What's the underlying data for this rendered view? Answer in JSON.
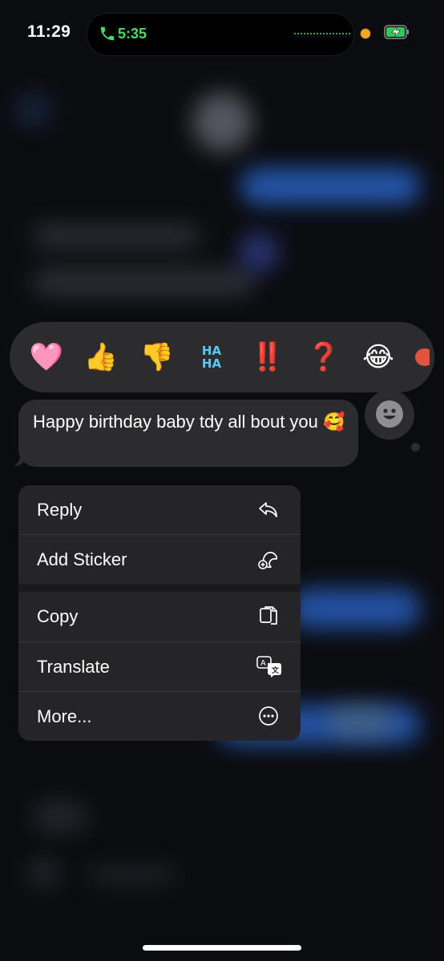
{
  "status_bar": {
    "time": "11:29",
    "call_timer": "5:35",
    "call_color": "#4cd964"
  },
  "reactions": [
    {
      "name": "heart",
      "glyph": "🩷"
    },
    {
      "name": "thumbs-up",
      "glyph": "👍"
    },
    {
      "name": "thumbs-down",
      "glyph": "👎"
    },
    {
      "name": "haha",
      "glyph": "HA HA"
    },
    {
      "name": "exclamation",
      "glyph": "‼️"
    },
    {
      "name": "question",
      "glyph": "❓"
    },
    {
      "name": "tears-of-joy",
      "glyph": "😂"
    }
  ],
  "message": {
    "text": "Happy birthday baby tdy all bout you 🥰"
  },
  "menu": {
    "items": [
      {
        "label": "Reply",
        "icon": "reply-arrow-icon"
      },
      {
        "label": "Add Sticker",
        "icon": "add-sticker-icon"
      },
      {
        "label": "Copy",
        "icon": "copy-icon"
      },
      {
        "label": "Translate",
        "icon": "translate-icon"
      },
      {
        "label": "More...",
        "icon": "more-ellipsis-icon"
      }
    ]
  },
  "colors": {
    "background": "#0b0c10",
    "surface": "#2c2c2e",
    "menu": "#252527",
    "accent_blue": "#2e6fe0"
  }
}
